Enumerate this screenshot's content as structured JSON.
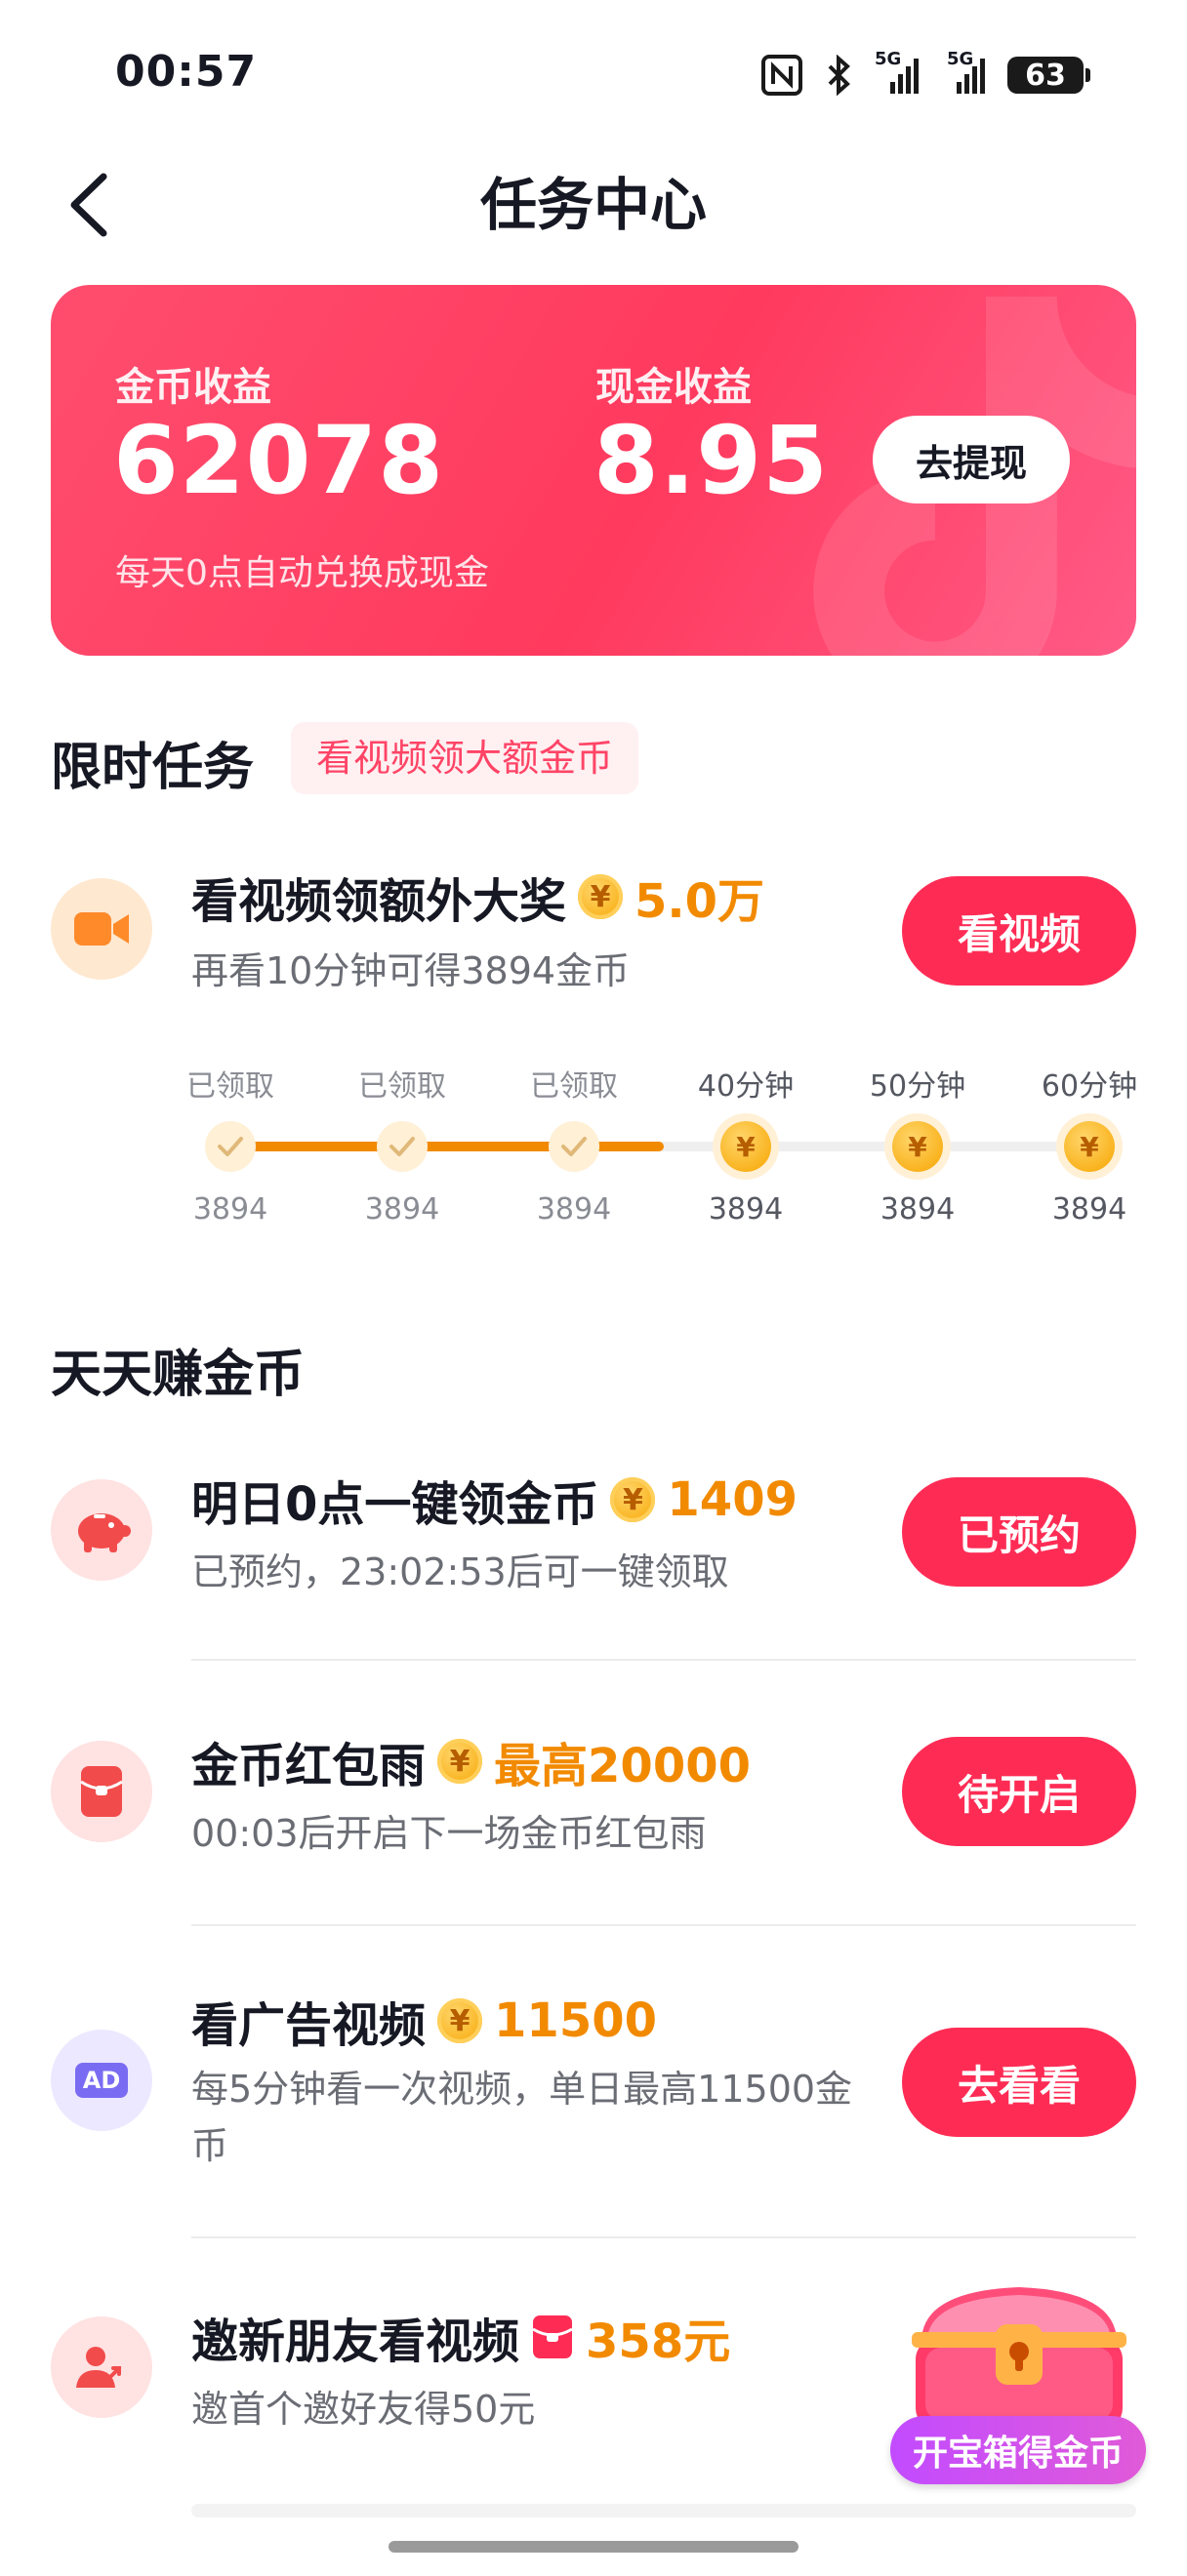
{
  "status_bar": {
    "time": "00:57",
    "battery": "63",
    "signal1": "5G",
    "signal2": "5G"
  },
  "header": {
    "title": "任务中心"
  },
  "earnings_card": {
    "coin_label": "金币收益",
    "coin_value": "62078",
    "cash_label": "现金收益",
    "cash_value": "8.95",
    "note": "每天0点自动兑换成现金",
    "withdraw_label": "去提现"
  },
  "limited_tasks": {
    "title": "限时任务",
    "tag": "看视频领大额金币",
    "video_task": {
      "title": "看视频领额外大奖",
      "reward": "5.0万",
      "desc": "再看10分钟可得3894金币",
      "button": "看视频"
    },
    "progress": {
      "steps": [
        {
          "label": "已领取",
          "value": "3894",
          "done": true
        },
        {
          "label": "已领取",
          "value": "3894",
          "done": true
        },
        {
          "label": "已领取",
          "value": "3894",
          "done": true
        },
        {
          "label": "40分钟",
          "value": "3894",
          "done": false
        },
        {
          "label": "50分钟",
          "value": "3894",
          "done": false
        },
        {
          "label": "60分钟",
          "value": "3894",
          "done": false
        }
      ]
    }
  },
  "daily": {
    "title": "天天赚金币",
    "tasks": [
      {
        "title": "明日0点一键领金币",
        "reward": "1409",
        "desc": "已预约，23:02:53后可一键领取",
        "button": "已预约",
        "icon": "piggy-bank-icon"
      },
      {
        "title": "金币红包雨",
        "reward": "最高20000",
        "desc": "00:03后开启下一场金币红包雨",
        "button": "待开启",
        "icon": "red-envelope-icon"
      },
      {
        "title": "看广告视频",
        "reward": "11500",
        "desc": "每5分钟看一次视频，单日最高11500金币",
        "button": "去看看",
        "icon": "ad-icon",
        "icon_text": "AD"
      },
      {
        "title": "邀新朋友看视频",
        "reward": "358元",
        "desc": "邀首个邀好友得50元",
        "icon": "invite-friends-icon"
      }
    ]
  },
  "treasure": {
    "label": "开宝箱得金币"
  },
  "coin_symbol": "¥",
  "colors": {
    "accent": "#fe2c55",
    "reward": "#f28a00",
    "card_gradient_start": "#ff4d6e",
    "card_gradient_end": "#ff5a86"
  }
}
